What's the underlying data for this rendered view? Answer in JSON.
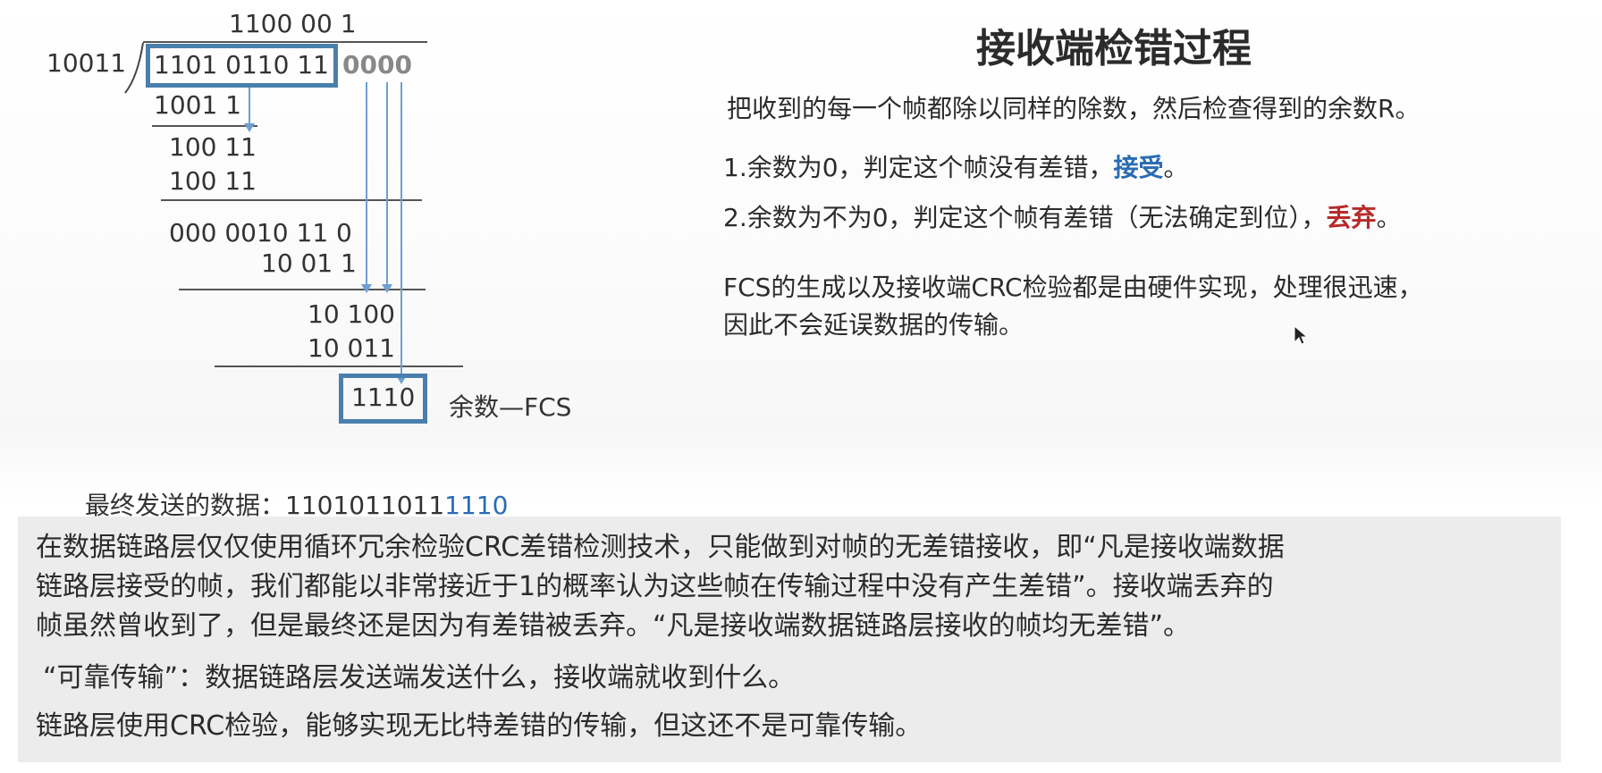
{
  "division": {
    "quotient": "1100 00 1",
    "divisor": "10011",
    "dividend": "1101 0110 11",
    "appended_zeros": "0000",
    "steps": [
      "1001 1",
      "100 11",
      "100 11",
      "000 0010 11  0",
      "10 01 1",
      "10 100",
      "10 011"
    ],
    "remainder": "1110",
    "remainder_label": "余数—FCS",
    "final_label": "最终发送的数据：",
    "final_data_main": "1101011011",
    "final_data_fcs": "1110"
  },
  "right": {
    "title": "接收端检错过程",
    "intro": "把收到的每一个帧都除以同样的除数，然后检查得到的余数R。",
    "rule1_prefix": "1.余数为0，判定这个帧没有差错，",
    "rule1_action": "接受",
    "rule1_suffix": "。",
    "rule2_prefix": "2.余数为不为0，判定这个帧有差错（无法确定到位），",
    "rule2_action": "丢弃",
    "rule2_suffix": "。",
    "fcs_line1": "FCS的生成以及接收端CRC检验都是由硬件实现，处理很迅速，",
    "fcs_line2": "因此不会延误数据的传输。"
  },
  "panel": {
    "para1_line1": "在数据链路层仅仅使用循环冗余检验CRC差错检测技术，只能做到对帧的无差错接收，即“凡是接收端数据",
    "para1_line2": "链路层接受的帧，我们都能以非常接近于1的概率认为这些帧在传输过程中没有产生差错”。接收端丢弃的",
    "para1_line3": "帧虽然曾收到了，但是最终还是因为有差错被丢弃。“凡是接收端数据链路层接收的帧均无差错”。",
    "para2": "“可靠传输”：数据链路层发送端发送什么，接收端就收到什么。",
    "para3": "链路层使用CRC检验，能够实现无比特差错的传输，但这还不是可靠传输。"
  },
  "colors": {
    "accent_blue": "#2a6cb3",
    "box_blue": "#4a7fad",
    "discard_red": "#b72b2b"
  }
}
